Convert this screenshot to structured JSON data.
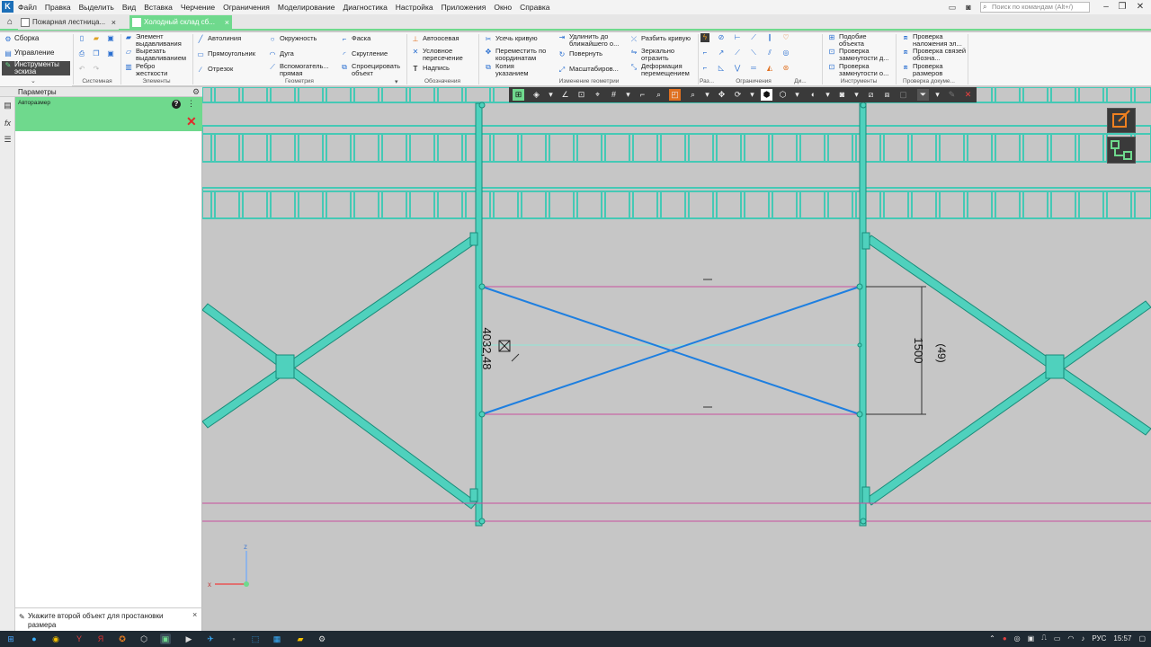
{
  "menu": {
    "items": [
      "Файл",
      "Правка",
      "Выделить",
      "Вид",
      "Вставка",
      "Черчение",
      "Ограничения",
      "Моделирование",
      "Диагностика",
      "Настройка",
      "Приложения",
      "Окно",
      "Справка"
    ],
    "search_placeholder": "Поиск по командам (Alt+/)"
  },
  "tabs": [
    {
      "label": "Пожарная лестница..."
    },
    {
      "label": "Холодный склад сб..."
    }
  ],
  "ribbon": {
    "left_tabs": [
      "Сборка",
      "Управление",
      "Инструменты эскиза"
    ],
    "system": {
      "title": "Системная"
    },
    "elements": {
      "title": "Элементы",
      "items": [
        "Элемент выдавливания",
        "Вырезать выдавливанием",
        "Ребро жесткости"
      ]
    },
    "geometry": {
      "title": "Геометрия",
      "items": [
        "Автолиния",
        "Прямоугольник",
        "Отрезок",
        "Окружность",
        "Дуга",
        "Вспомогатель... прямая",
        "Фаска",
        "Скругление",
        "Спроецировать объект"
      ]
    },
    "notation": {
      "title": "Обозначения",
      "items": [
        "Автоосевая",
        "Условное пересечение",
        "Надпись"
      ]
    },
    "geom_change": {
      "title": "Изменение геометрии",
      "items": [
        "Усечь кривую",
        "Переместить по координатам",
        "Копия указанием",
        "Удлинить до ближайшего о...",
        "Повернуть",
        "Масштабиров...",
        "Разбить кривую",
        "Зеркально отразить",
        "Деформация перемещением"
      ]
    },
    "constraints": {
      "title": "Ограничения"
    },
    "ra": {
      "title": "Раз..."
    },
    "di": {
      "title": "Ди..."
    },
    "tools": {
      "title": "Инструменты",
      "items": [
        "Подобие объекта",
        "Проверка замкнутости д...",
        "Проверка замкнутости о..."
      ]
    },
    "doc_check": {
      "title": "Проверка докуме...",
      "items": [
        "Проверка наложения эл...",
        "Проверка связей обозна...",
        "Проверка размеров"
      ]
    }
  },
  "panel": {
    "title": "Параметры",
    "autosize_label": "Авторазмер",
    "hint": "Укажите второй объект для простановки размера"
  },
  "canvas": {
    "dim_value": "4032,48",
    "dim_vertical": "1500",
    "dim_vertical_aux": "(49)",
    "axis_x": "x",
    "axis_z": "z"
  },
  "taskbar": {
    "lang": "РУС",
    "time": "15:57"
  },
  "colors": {
    "accent_green": "#6fd98d",
    "beam": "#4fd1bd",
    "blue_line": "#1e7fe0",
    "magenta_line": "#c8509f"
  }
}
